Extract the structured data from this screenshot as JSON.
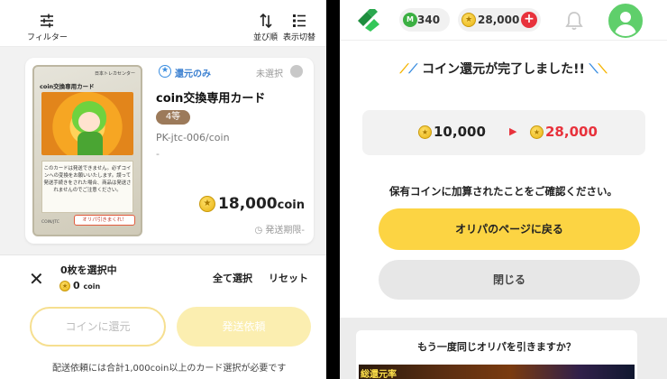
{
  "left": {
    "toolbar": {
      "filter_label": "フィルター",
      "sort_label": "並び順",
      "view_label": "表示切替"
    },
    "card": {
      "return_badge": "還元のみ",
      "selection_status": "未選択",
      "title": "coin交換専用カード",
      "grade": "4等",
      "code": "PK-jtc-006/coin",
      "dash": "-",
      "price_value": "18,000",
      "price_unit": "coin",
      "shipping": "発送期限-",
      "tcg_header": "日本トレカセンター",
      "tcg_name": "coin交換専用カード",
      "tcg_text": "このカードは発送できません。必ずコインへの変換をお願いいたします。誤って発送手続きをされた場合、商品は発送されませんのでご注意ください。",
      "tcg_code": "COIN/JTC",
      "tcg_button": "オリパ引きまくれ！"
    },
    "sheet": {
      "selected_count": "0枚を選択中",
      "selected_coin_value": "0",
      "selected_coin_unit": "coin",
      "select_all": "全て選択",
      "reset": "リセット",
      "return_button": "コインに還元",
      "ship_button": "発送依頼",
      "note": "配送依頼には合計1,000coin以上のカード選択が必要です"
    }
  },
  "right": {
    "header": {
      "m_points": "340",
      "coins": "28,000"
    },
    "title": "コイン還元が完了しました!!",
    "result": {
      "from": "10,000",
      "to": "28,000"
    },
    "confirm_text": "保有コインに加算されたことをご確認ください。",
    "back_button": "オリパのページに戻る",
    "close_button": "閉じる",
    "again_text": "もう一度同じオリパを引きますか？",
    "banner_text": "総還元率"
  },
  "colors": {
    "accent_yellow": "#fcd443",
    "red": "#e8323c",
    "green": "#3cb043",
    "blue": "#3a8de0"
  }
}
